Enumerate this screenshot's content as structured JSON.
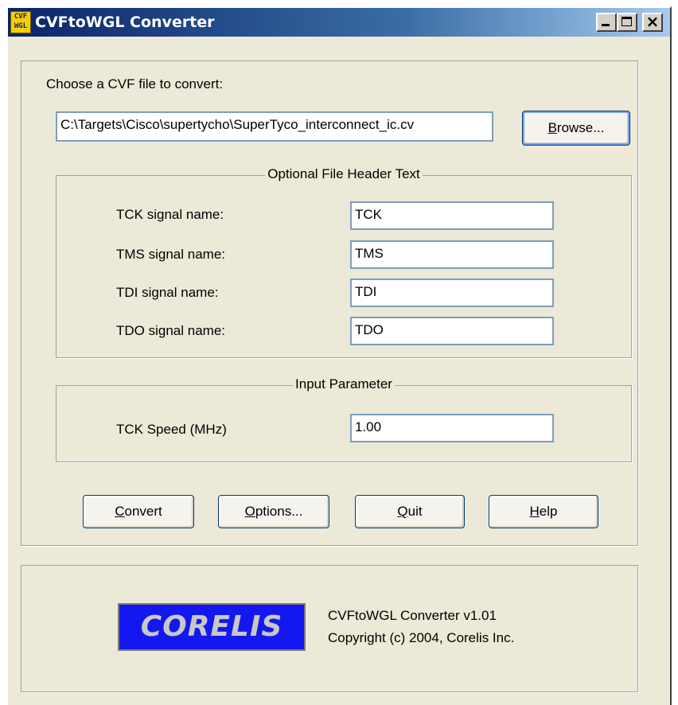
{
  "window": {
    "title": "CVFtoWGL Converter",
    "icon_text_top": "CVF",
    "icon_text_bottom": "WGL",
    "min_glyph": "",
    "close_glyph": "×"
  },
  "file": {
    "prompt": "Choose a CVF file to convert:",
    "path": "C:\\Targets\\Cisco\\supertycho\\SuperTyco_interconnect_ic.cv",
    "browse_prefix": "B",
    "browse_rest": "rowse..."
  },
  "header_group": {
    "legend": "Optional File Header Text",
    "rows": [
      {
        "label": "TCK signal name:",
        "value": "TCK"
      },
      {
        "label": "TMS signal name:",
        "value": "TMS"
      },
      {
        "label": "TDI signal name:",
        "value": "TDI"
      },
      {
        "label": "TDO signal name:",
        "value": "TDO"
      }
    ]
  },
  "input_group": {
    "legend": "Input Parameter",
    "speed_label": "TCK Speed (MHz)",
    "speed_value": "1.00"
  },
  "buttons": {
    "convert_u": "C",
    "convert_rest": "onvert",
    "options_u": "O",
    "options_rest": "ptions...",
    "quit_u": "Q",
    "quit_rest": "uit",
    "help_u": "H",
    "help_rest": "elp"
  },
  "about": {
    "logo_text": "CORELIS",
    "version": "CVFtoWGL Converter v1.01",
    "copyright": "Copyright (c) 2004, Corelis Inc."
  },
  "colors": {
    "title_bar": "#0a246a",
    "window_bg": "#ece9d8",
    "logo_bg": "#1418f0"
  }
}
